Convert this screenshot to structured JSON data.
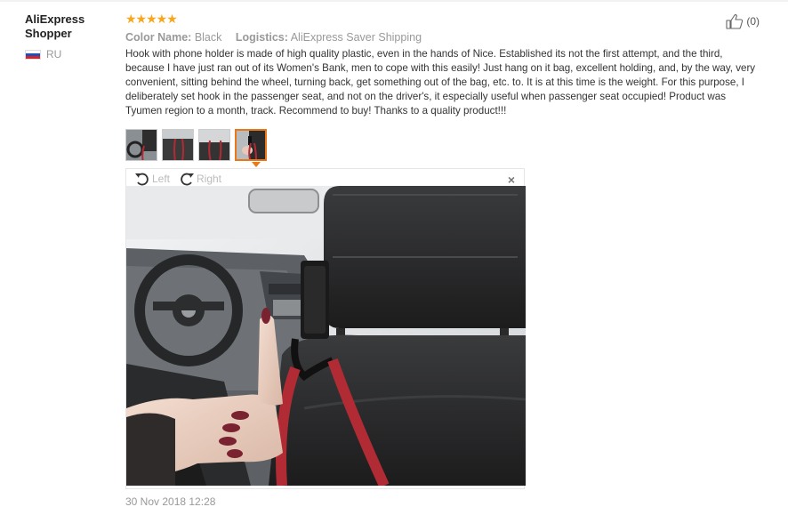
{
  "author": {
    "name": "AliExpress Shopper",
    "country": "RU"
  },
  "review": {
    "rating": 5,
    "stars": "★★★★★",
    "color_label": "Color Name:",
    "color_value": "Black",
    "logistics_label": "Logistics:",
    "logistics_value": "AliExpress Saver Shipping",
    "text": "Hook with phone holder is made of high quality plastic, even in the hands of Nice. Established its not the first attempt, and the third, because I have just ran out of its Women's Bank, men to cope with this easily! Just hang on it bag, excellent holding, and, by the way, very convenient, sitting behind the wheel, turning back, get something out of the bag, etc. to. It is at this time is the weight. For this purpose, I deliberately set hook in the passenger seat, and not on the driver's, it especially useful when passenger seat occupied! Product was Tyumen region to a month, track. Recommend to buy! Thanks to a quality product!!!",
    "helpful_count": "(0)",
    "date": "30 Nov 2018 12:28"
  },
  "viewer": {
    "rotate_left": "Left",
    "rotate_right": "Right",
    "close": "×",
    "selected_thumbnail": 4
  },
  "icons": {
    "like": "thumbs-up-icon",
    "rotate_left": "rotate-left-icon",
    "rotate_right": "rotate-right-icon",
    "close": "close-icon",
    "flag": "russia-flag-icon"
  },
  "colors": {
    "star": "#f7a71e",
    "active_thumb": "#e8781a",
    "muted": "#999999"
  }
}
